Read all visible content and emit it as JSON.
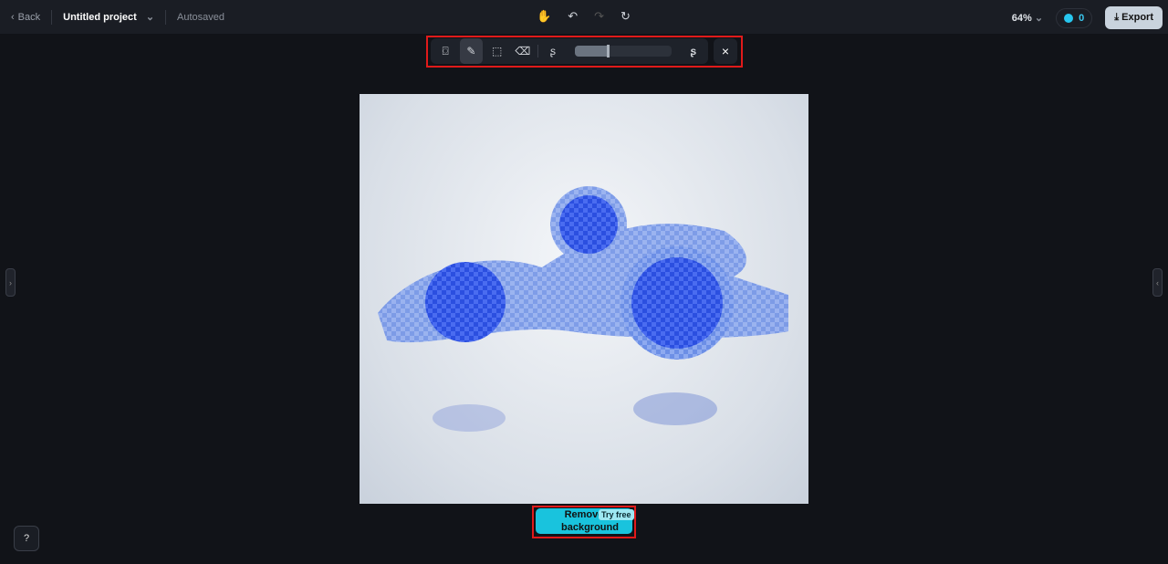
{
  "header": {
    "back_label": "Back",
    "project_title": "Untitled project",
    "save_status": "Autosaved",
    "zoom": "64%",
    "credits": "0",
    "export_label": "Export"
  },
  "toolbar": {
    "brush_size_percent": 34,
    "close_icon": "×"
  },
  "action": {
    "remove_bg_label_1": "Remove",
    "remove_bg_label_2": "background",
    "badge": "Try free"
  },
  "colors": {
    "accent": "#19c3dd",
    "mask": "#2f55e6",
    "highlight": "#e01a1a"
  }
}
